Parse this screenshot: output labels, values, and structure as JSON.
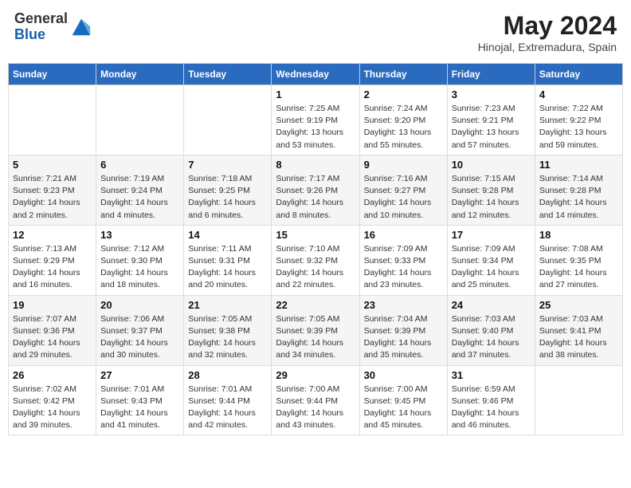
{
  "logo": {
    "general": "General",
    "blue": "Blue"
  },
  "title": {
    "month_year": "May 2024",
    "location": "Hinojal, Extremadura, Spain"
  },
  "weekdays": [
    "Sunday",
    "Monday",
    "Tuesday",
    "Wednesday",
    "Thursday",
    "Friday",
    "Saturday"
  ],
  "weeks": [
    [
      {
        "day": "",
        "info": ""
      },
      {
        "day": "",
        "info": ""
      },
      {
        "day": "",
        "info": ""
      },
      {
        "day": "1",
        "info": "Sunrise: 7:25 AM\nSunset: 9:19 PM\nDaylight: 13 hours and 53 minutes."
      },
      {
        "day": "2",
        "info": "Sunrise: 7:24 AM\nSunset: 9:20 PM\nDaylight: 13 hours and 55 minutes."
      },
      {
        "day": "3",
        "info": "Sunrise: 7:23 AM\nSunset: 9:21 PM\nDaylight: 13 hours and 57 minutes."
      },
      {
        "day": "4",
        "info": "Sunrise: 7:22 AM\nSunset: 9:22 PM\nDaylight: 13 hours and 59 minutes."
      }
    ],
    [
      {
        "day": "5",
        "info": "Sunrise: 7:21 AM\nSunset: 9:23 PM\nDaylight: 14 hours and 2 minutes."
      },
      {
        "day": "6",
        "info": "Sunrise: 7:19 AM\nSunset: 9:24 PM\nDaylight: 14 hours and 4 minutes."
      },
      {
        "day": "7",
        "info": "Sunrise: 7:18 AM\nSunset: 9:25 PM\nDaylight: 14 hours and 6 minutes."
      },
      {
        "day": "8",
        "info": "Sunrise: 7:17 AM\nSunset: 9:26 PM\nDaylight: 14 hours and 8 minutes."
      },
      {
        "day": "9",
        "info": "Sunrise: 7:16 AM\nSunset: 9:27 PM\nDaylight: 14 hours and 10 minutes."
      },
      {
        "day": "10",
        "info": "Sunrise: 7:15 AM\nSunset: 9:28 PM\nDaylight: 14 hours and 12 minutes."
      },
      {
        "day": "11",
        "info": "Sunrise: 7:14 AM\nSunset: 9:28 PM\nDaylight: 14 hours and 14 minutes."
      }
    ],
    [
      {
        "day": "12",
        "info": "Sunrise: 7:13 AM\nSunset: 9:29 PM\nDaylight: 14 hours and 16 minutes."
      },
      {
        "day": "13",
        "info": "Sunrise: 7:12 AM\nSunset: 9:30 PM\nDaylight: 14 hours and 18 minutes."
      },
      {
        "day": "14",
        "info": "Sunrise: 7:11 AM\nSunset: 9:31 PM\nDaylight: 14 hours and 20 minutes."
      },
      {
        "day": "15",
        "info": "Sunrise: 7:10 AM\nSunset: 9:32 PM\nDaylight: 14 hours and 22 minutes."
      },
      {
        "day": "16",
        "info": "Sunrise: 7:09 AM\nSunset: 9:33 PM\nDaylight: 14 hours and 23 minutes."
      },
      {
        "day": "17",
        "info": "Sunrise: 7:09 AM\nSunset: 9:34 PM\nDaylight: 14 hours and 25 minutes."
      },
      {
        "day": "18",
        "info": "Sunrise: 7:08 AM\nSunset: 9:35 PM\nDaylight: 14 hours and 27 minutes."
      }
    ],
    [
      {
        "day": "19",
        "info": "Sunrise: 7:07 AM\nSunset: 9:36 PM\nDaylight: 14 hours and 29 minutes."
      },
      {
        "day": "20",
        "info": "Sunrise: 7:06 AM\nSunset: 9:37 PM\nDaylight: 14 hours and 30 minutes."
      },
      {
        "day": "21",
        "info": "Sunrise: 7:05 AM\nSunset: 9:38 PM\nDaylight: 14 hours and 32 minutes."
      },
      {
        "day": "22",
        "info": "Sunrise: 7:05 AM\nSunset: 9:39 PM\nDaylight: 14 hours and 34 minutes."
      },
      {
        "day": "23",
        "info": "Sunrise: 7:04 AM\nSunset: 9:39 PM\nDaylight: 14 hours and 35 minutes."
      },
      {
        "day": "24",
        "info": "Sunrise: 7:03 AM\nSunset: 9:40 PM\nDaylight: 14 hours and 37 minutes."
      },
      {
        "day": "25",
        "info": "Sunrise: 7:03 AM\nSunset: 9:41 PM\nDaylight: 14 hours and 38 minutes."
      }
    ],
    [
      {
        "day": "26",
        "info": "Sunrise: 7:02 AM\nSunset: 9:42 PM\nDaylight: 14 hours and 39 minutes."
      },
      {
        "day": "27",
        "info": "Sunrise: 7:01 AM\nSunset: 9:43 PM\nDaylight: 14 hours and 41 minutes."
      },
      {
        "day": "28",
        "info": "Sunrise: 7:01 AM\nSunset: 9:44 PM\nDaylight: 14 hours and 42 minutes."
      },
      {
        "day": "29",
        "info": "Sunrise: 7:00 AM\nSunset: 9:44 PM\nDaylight: 14 hours and 43 minutes."
      },
      {
        "day": "30",
        "info": "Sunrise: 7:00 AM\nSunset: 9:45 PM\nDaylight: 14 hours and 45 minutes."
      },
      {
        "day": "31",
        "info": "Sunrise: 6:59 AM\nSunset: 9:46 PM\nDaylight: 14 hours and 46 minutes."
      },
      {
        "day": "",
        "info": ""
      }
    ]
  ]
}
